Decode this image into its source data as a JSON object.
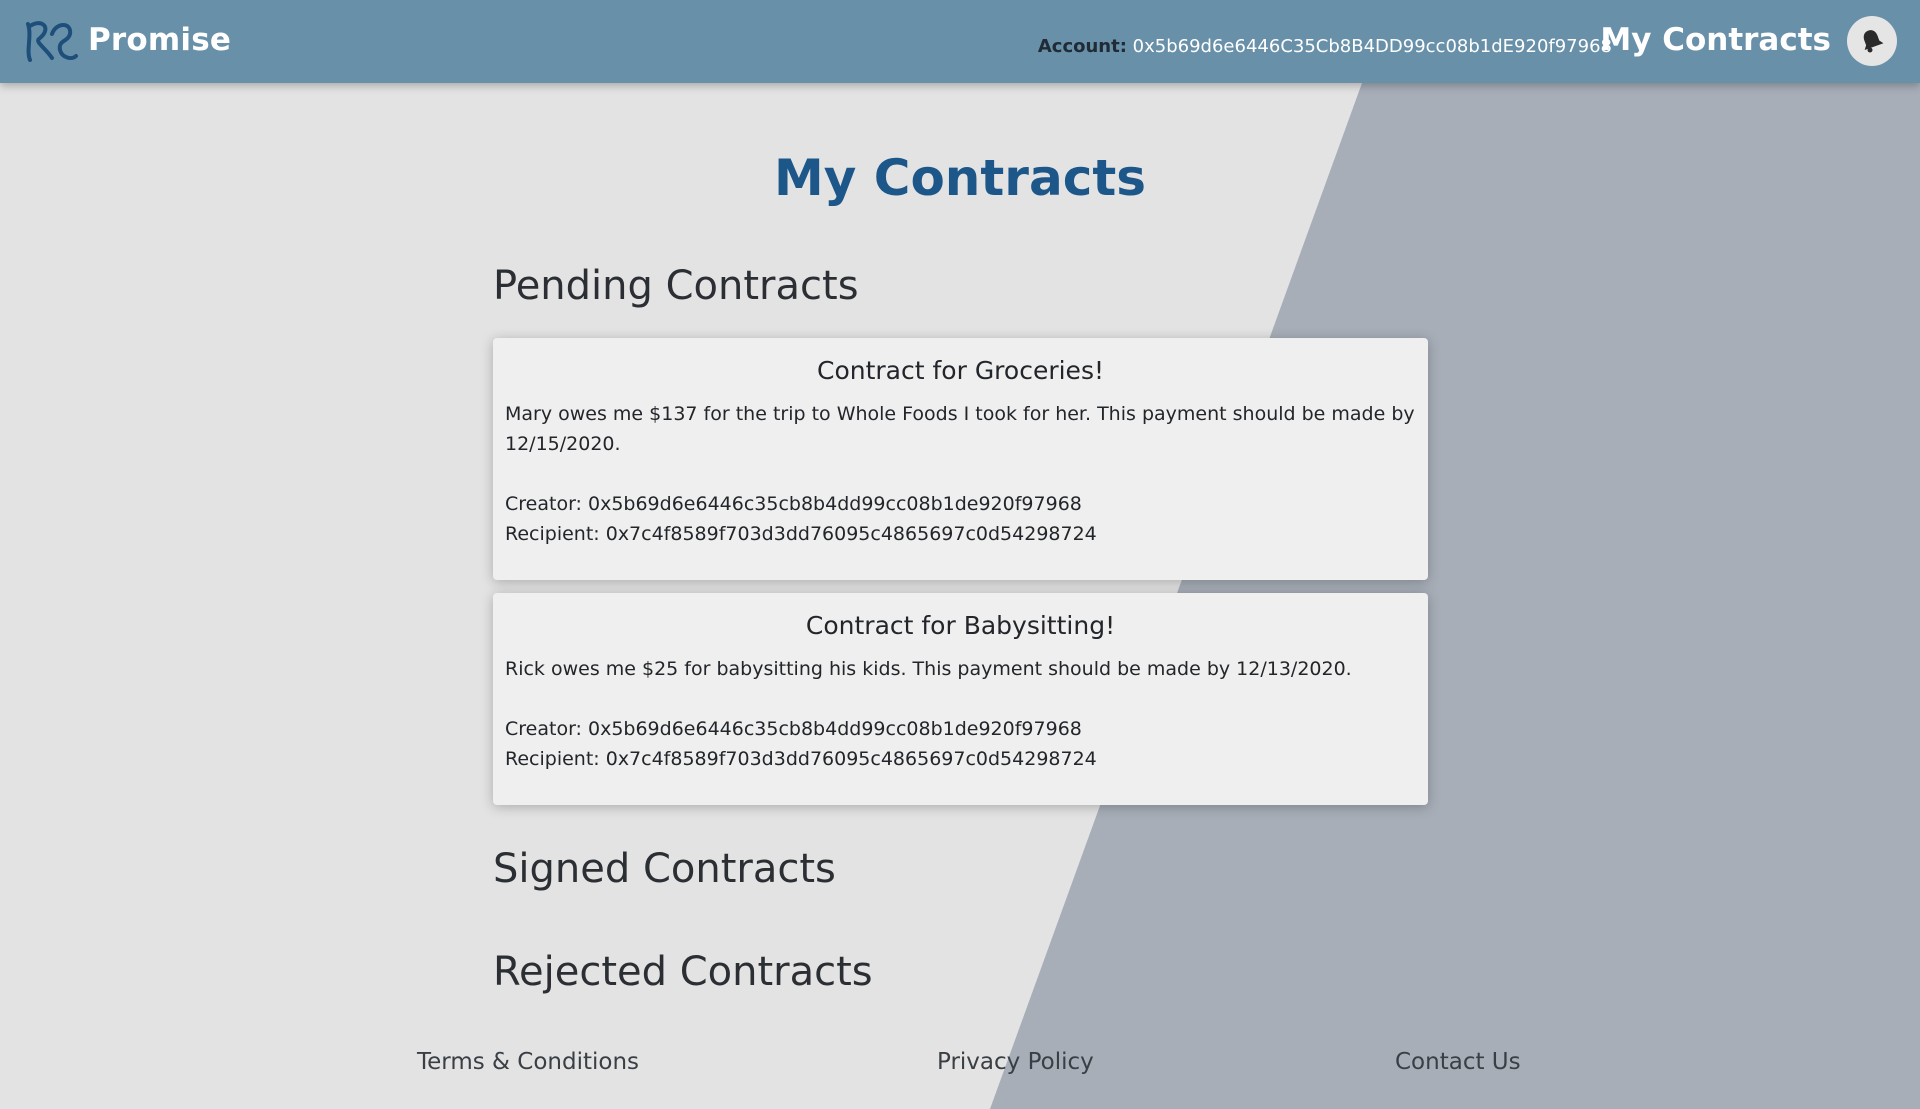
{
  "header": {
    "brand_name": "Promise",
    "account_label": "Account:",
    "account_value": "0x5b69d6e6446C35Cb8B4DD99cc08b1dE920f97968",
    "nav_link": "My Contracts"
  },
  "main": {
    "title": "My Contracts",
    "sections": {
      "pending": "Pending Contracts",
      "signed": "Signed Contracts",
      "rejected": "Rejected Contracts"
    },
    "pending_contracts": [
      {
        "title": "Contract for Groceries!",
        "description": "Mary owes me $137 for the trip to Whole Foods I took for her. This payment should be made by 12/15/2020.",
        "creator": "Creator: 0x5b69d6e6446c35cb8b4dd99cc08b1de920f97968",
        "recipient": "Recipient: 0x7c4f8589f703d3dd76095c4865697c0d54298724"
      },
      {
        "title": "Contract for Babysitting!",
        "description": "Rick owes me $25 for babysitting his kids. This payment should be made by 12/13/2020.",
        "creator": "Creator: 0x5b69d6e6446c35cb8b4dd99cc08b1de920f97968",
        "recipient": "Recipient: 0x7c4f8589f703d3dd76095c4865697c0d54298724"
      }
    ]
  },
  "footer": {
    "terms": "Terms & Conditions",
    "privacy": "Privacy Policy",
    "contact": "Contact Us"
  },
  "colors": {
    "navbar": "#6890a9",
    "background_light": "#e3e3e4",
    "background_dark": "#a7aeb8",
    "title": "#1d5688",
    "card": "#efefef"
  },
  "icons": {
    "logo": "promise-logo-icon",
    "avatar": "bell-icon"
  }
}
